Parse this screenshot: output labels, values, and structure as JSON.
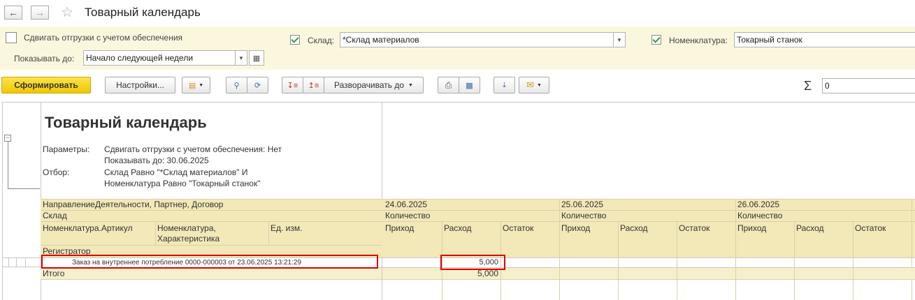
{
  "header": {
    "title": "Товарный календарь"
  },
  "params": {
    "shift_label": "Сдвигать отгрузки с учетом обеспечения",
    "shift_checked": false,
    "warehouse_label": "Склад:",
    "warehouse_value": "*Склад материалов",
    "warehouse_checked": true,
    "nomenclature_label": "Номенклатура:",
    "nomenclature_value": "Токарный станок",
    "nomenclature_checked": true,
    "showuntil_label": "Показывать до:",
    "showuntil_value": "Начало следующей недели"
  },
  "toolbar": {
    "generate_label": "Сформировать",
    "settings_label": "Настройки...",
    "expand_label": "Разворачивать до",
    "sum_value": "0"
  },
  "report": {
    "title": "Товарный календарь",
    "params_label": "Параметры:",
    "params_line1": "Сдвигать отгрузки с учетом обеспечения: Нет",
    "params_line2": "Показывать до: 30.06.2025",
    "filter_label": "Отбор:",
    "filter_line1": "Склад Равно \"*Склад материалов\" И",
    "filter_line2": "Номенклатура Равно \"Токарный станок\"",
    "col_group1": "НаправлениеДеятельности, Партнер, Договор",
    "col_group2": "Склад",
    "col_article": "Номенклатура.Артикул",
    "col_nomchar": "Номенклатура, Характеристика",
    "col_unit": "Ед. изм.",
    "col_registrar": "Регистратор",
    "dates": [
      "24.06.2025",
      "25.06.2025",
      "26.06.2025"
    ],
    "qty_label": "Количество",
    "in_label": "Приход",
    "out_label": "Расход",
    "rest_label": "Остаток",
    "row_doc": "Заказ на внутреннее потребление 0000-000003 от 23.06.2025 13:21:29",
    "row_out": "5,000",
    "total_label": "Итого",
    "total_out": "5,000"
  }
}
